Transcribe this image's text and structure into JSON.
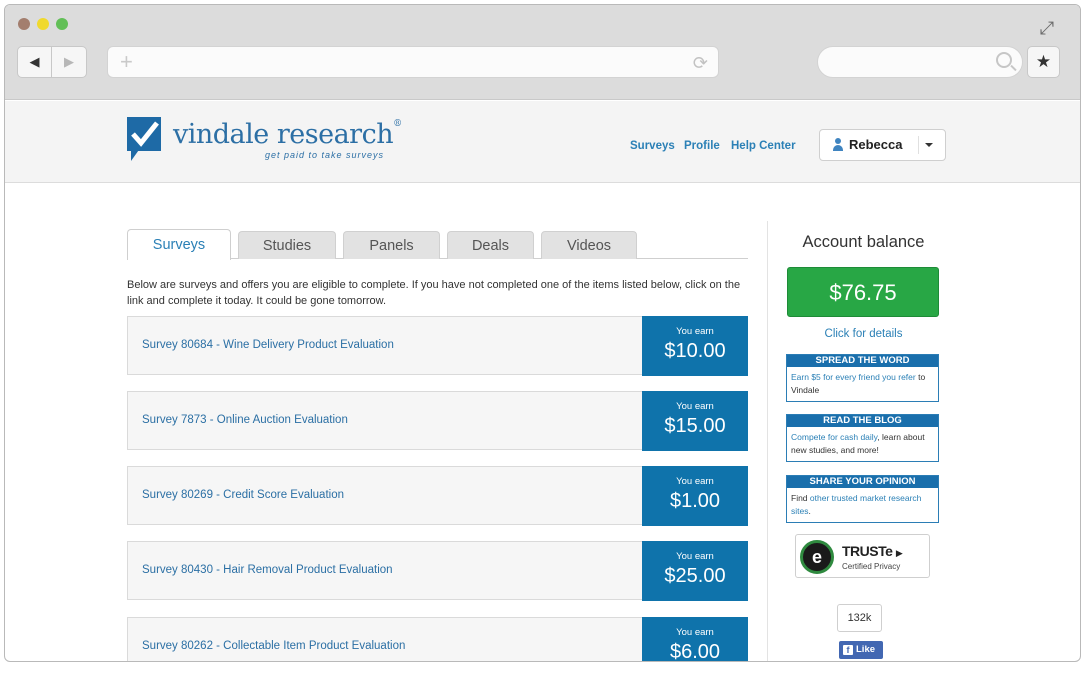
{
  "browser": {
    "icons": [
      "back-icon",
      "forward-icon",
      "plus-icon",
      "reload-icon",
      "search-icon",
      "star-icon",
      "resize-icon"
    ]
  },
  "header": {
    "logo_word": "vindale research",
    "logo_reg": "®",
    "logo_tagline": "get paid to take surveys",
    "nav": [
      "Surveys",
      "Profile",
      "Help Center"
    ],
    "user_name": "Rebecca"
  },
  "tabs": [
    "Surveys",
    "Studies",
    "Panels",
    "Deals",
    "Videos"
  ],
  "intro_text": "Below are surveys and offers you are eligible to complete. If you have not completed one of the items listed below, click on the link and complete it today. It could be gone tomorrow.",
  "surveys": [
    {
      "title": "Survey 80684 - Wine Delivery Product Evaluation",
      "earn_label": "You earn",
      "earn_value": "$10.00"
    },
    {
      "title": "Survey 7873 - Online Auction Evaluation",
      "earn_label": "You earn",
      "earn_value": "$15.00"
    },
    {
      "title": "Survey 80269 - Credit Score Evaluation",
      "earn_label": "You earn",
      "earn_value": "$1.00"
    },
    {
      "title": "Survey 80430 - Hair Removal Product Evaluation",
      "earn_label": "You earn",
      "earn_value": "$25.00"
    },
    {
      "title": "Survey 80262 - Collectable Item Product Evaluation",
      "earn_label": "You earn",
      "earn_value": "$6.00"
    }
  ],
  "sidebar": {
    "account_title": "Account balance",
    "balance": "$76.75",
    "details_link": "Click for details",
    "promos": [
      {
        "head": "SPREAD THE WORD",
        "link": "Earn $5 for every friend you refer",
        "text": " to Vindale"
      },
      {
        "head": "READ THE BLOG",
        "link": "Compete for cash daily",
        "text": ", learn about new studies, and more!"
      },
      {
        "head": "SHARE YOUR OPINION",
        "pre": "Find ",
        "link": "other trusted market research sites",
        "text": "."
      }
    ],
    "truste": {
      "seal": "e",
      "name": "TRUSTe",
      "arrow": "▶",
      "sub": "Certified Privacy"
    },
    "facebook": {
      "count": "132k",
      "label": "Like",
      "f": "f"
    }
  },
  "colors": {
    "brand_blue": "#0f73ab",
    "link_blue": "#2b80b6",
    "balance_green": "#28a745"
  }
}
